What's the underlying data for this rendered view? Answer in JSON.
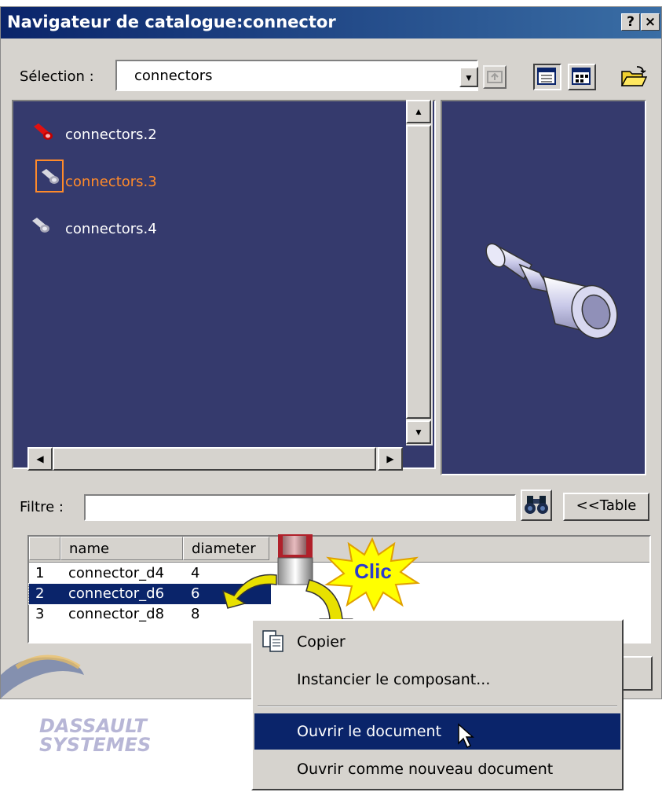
{
  "window": {
    "title": "Navigateur de catalogue:connector",
    "help_btn": "?",
    "close_btn": "×"
  },
  "selection": {
    "label": "Sélection :",
    "value": "connectors"
  },
  "list": {
    "items": [
      {
        "label": "connectors.2",
        "color": "#ffffff",
        "icon": "red-connector-icon"
      },
      {
        "label": "connectors.3",
        "color": "#ff8a2a",
        "icon": "gray-connector-icon"
      },
      {
        "label": "connectors.4",
        "color": "#ffffff",
        "icon": "gray-connector-icon"
      }
    ],
    "background": "#353a6d"
  },
  "filter": {
    "label": "Filtre :",
    "value": "",
    "table_button": "<<Table"
  },
  "table": {
    "headers": [
      "name",
      "diameter"
    ],
    "rows": [
      {
        "index": "1",
        "name": "connector_d4",
        "diameter": "4"
      },
      {
        "index": "2",
        "name": "connector_d6",
        "diameter": "6"
      },
      {
        "index": "3",
        "name": "connector_d8",
        "diameter": "8"
      }
    ],
    "selected_index": "2"
  },
  "callout": {
    "text": "Clic"
  },
  "context_menu": {
    "items": [
      {
        "label": "Copier"
      },
      {
        "label": "Instancier le composant..."
      },
      {
        "label": "Ouvrir le document"
      },
      {
        "label": "Ouvrir comme nouveau document"
      }
    ]
  },
  "logo": {
    "line1": "DASSAULT",
    "line2": "SYSTEMES"
  }
}
